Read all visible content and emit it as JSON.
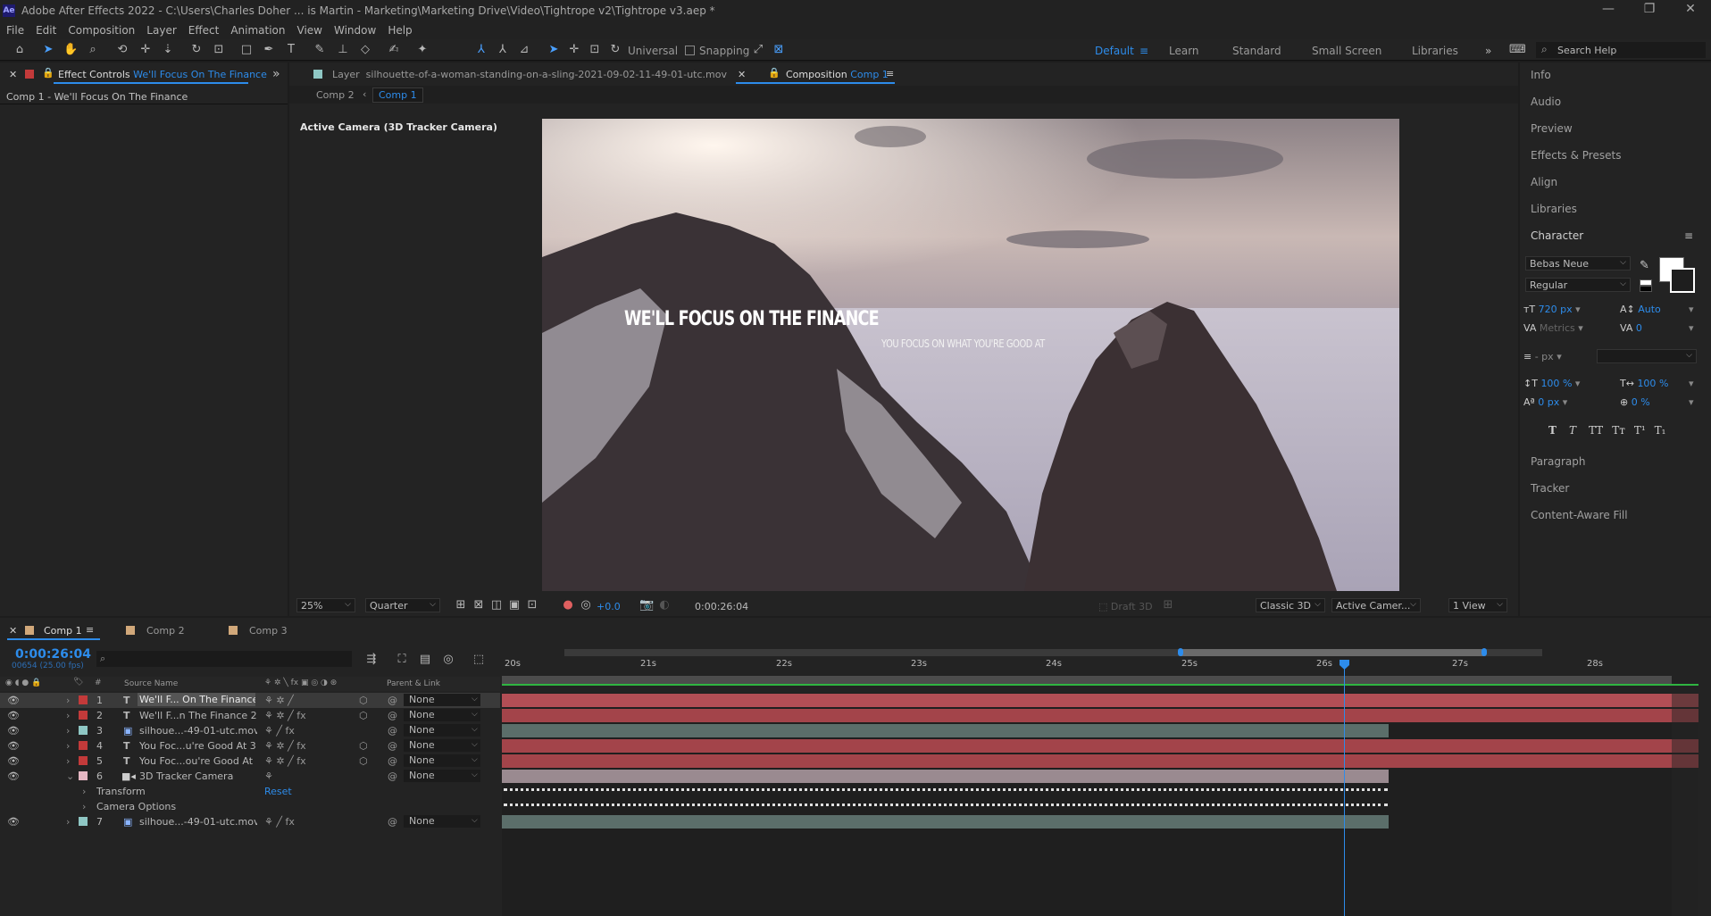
{
  "window": {
    "title": "Adobe After Effects 2022 - C:\\Users\\Charles Doher ... is Martin - Marketing\\Marketing Drive\\Video\\Tightrope v2\\Tightrope v3.aep *",
    "logo": "Ae"
  },
  "menu": [
    "File",
    "Edit",
    "Composition",
    "Layer",
    "Effect",
    "Animation",
    "View",
    "Window",
    "Help"
  ],
  "toolbar": {
    "universal": "Universal",
    "snapping": "Snapping",
    "workspaces": [
      "Default",
      "Learn",
      "Standard",
      "Small Screen",
      "Libraries"
    ],
    "search_placeholder": "Search Help"
  },
  "effect_controls": {
    "tab_label": "Effect Controls",
    "tab_target": "We'll Focus On The Finance",
    "subtitle": "Comp 1 - We'll Focus On The Finance"
  },
  "layer_tab": {
    "label": "Layer",
    "name": "silhouette-of-a-woman-standing-on-a-sling-2021-09-02-11-49-01-utc.mov"
  },
  "comp_tab": {
    "label": "Composition",
    "name": "Comp 1"
  },
  "breadcrumb": [
    "Comp 2",
    "Comp 1"
  ],
  "viewer": {
    "camera_label": "Active Camera (3D Tracker Camera)",
    "text_left": "WE'LL FOCUS ON THE FINANCE",
    "text_right": "YOU FOCUS ON WHAT YOU'RE GOOD AT"
  },
  "viewer_bar": {
    "zoom": "25%",
    "resolution": "Quarter",
    "exposure": "+0.0",
    "timecode": "0:00:26:04",
    "draft3d": "Draft 3D",
    "renderer": "Classic 3D",
    "camera": "Active Camer...",
    "views": "1 View"
  },
  "right_panels": [
    "Info",
    "Audio",
    "Preview",
    "Effects & Presets",
    "Align",
    "Libraries"
  ],
  "character": {
    "title": "Character",
    "font": "Bebas Neue",
    "style": "Regular",
    "size": "720",
    "size_unit": "px",
    "leading": "Auto",
    "kerning": "Metrics",
    "tracking": "0",
    "stroke": "- px",
    "vscale": "100",
    "hscale": "100",
    "pct": "%",
    "baseline": "0",
    "baseline_unit": "px",
    "tsume": "0",
    "tsume_unit": "%",
    "styles": [
      "T",
      "T",
      "TT",
      "Tт",
      "T¹",
      "T₁"
    ]
  },
  "right_panels_bottom": [
    "Paragraph",
    "Tracker",
    "Content-Aware Fill"
  ],
  "timeline": {
    "tabs": [
      "Comp 1",
      "Comp 2",
      "Comp 3"
    ],
    "timecode": "0:00:26:04",
    "frames": "00654 (25.00 fps)",
    "ruler": [
      "20s",
      "21s",
      "22s",
      "23s",
      "24s",
      "25s",
      "26s",
      "27s",
      "28s"
    ],
    "col_source": "Source Name",
    "col_parent": "Parent & Link",
    "layers": [
      {
        "num": "1",
        "icon": "T",
        "name": "We'll F... On The Finance",
        "parent": "None",
        "color": "#c33a3a"
      },
      {
        "num": "2",
        "icon": "T",
        "name": "We'll F...n The Finance 2",
        "parent": "None",
        "color": "#c33a3a"
      },
      {
        "num": "3",
        "icon": "▣",
        "name": "silhoue...-49-01-utc.mov",
        "parent": "None",
        "color": "#8fc7c4"
      },
      {
        "num": "4",
        "icon": "T",
        "name": "You Foc...u're Good At 3",
        "parent": "None",
        "color": "#c33a3a"
      },
      {
        "num": "5",
        "icon": "T",
        "name": "You Foc...ou're Good At",
        "parent": "None",
        "color": "#c33a3a"
      },
      {
        "num": "6",
        "icon": "■",
        "name": "3D Tracker Camera",
        "parent": "None",
        "color": "#e5b7c3"
      }
    ],
    "sub_rows": [
      "Transform",
      "Camera Options"
    ],
    "reset": "Reset",
    "layer7": {
      "num": "7",
      "icon": "▣",
      "name": "silhoue...-49-01-utc.mov",
      "parent": "None",
      "color": "#8fc7c4"
    }
  }
}
